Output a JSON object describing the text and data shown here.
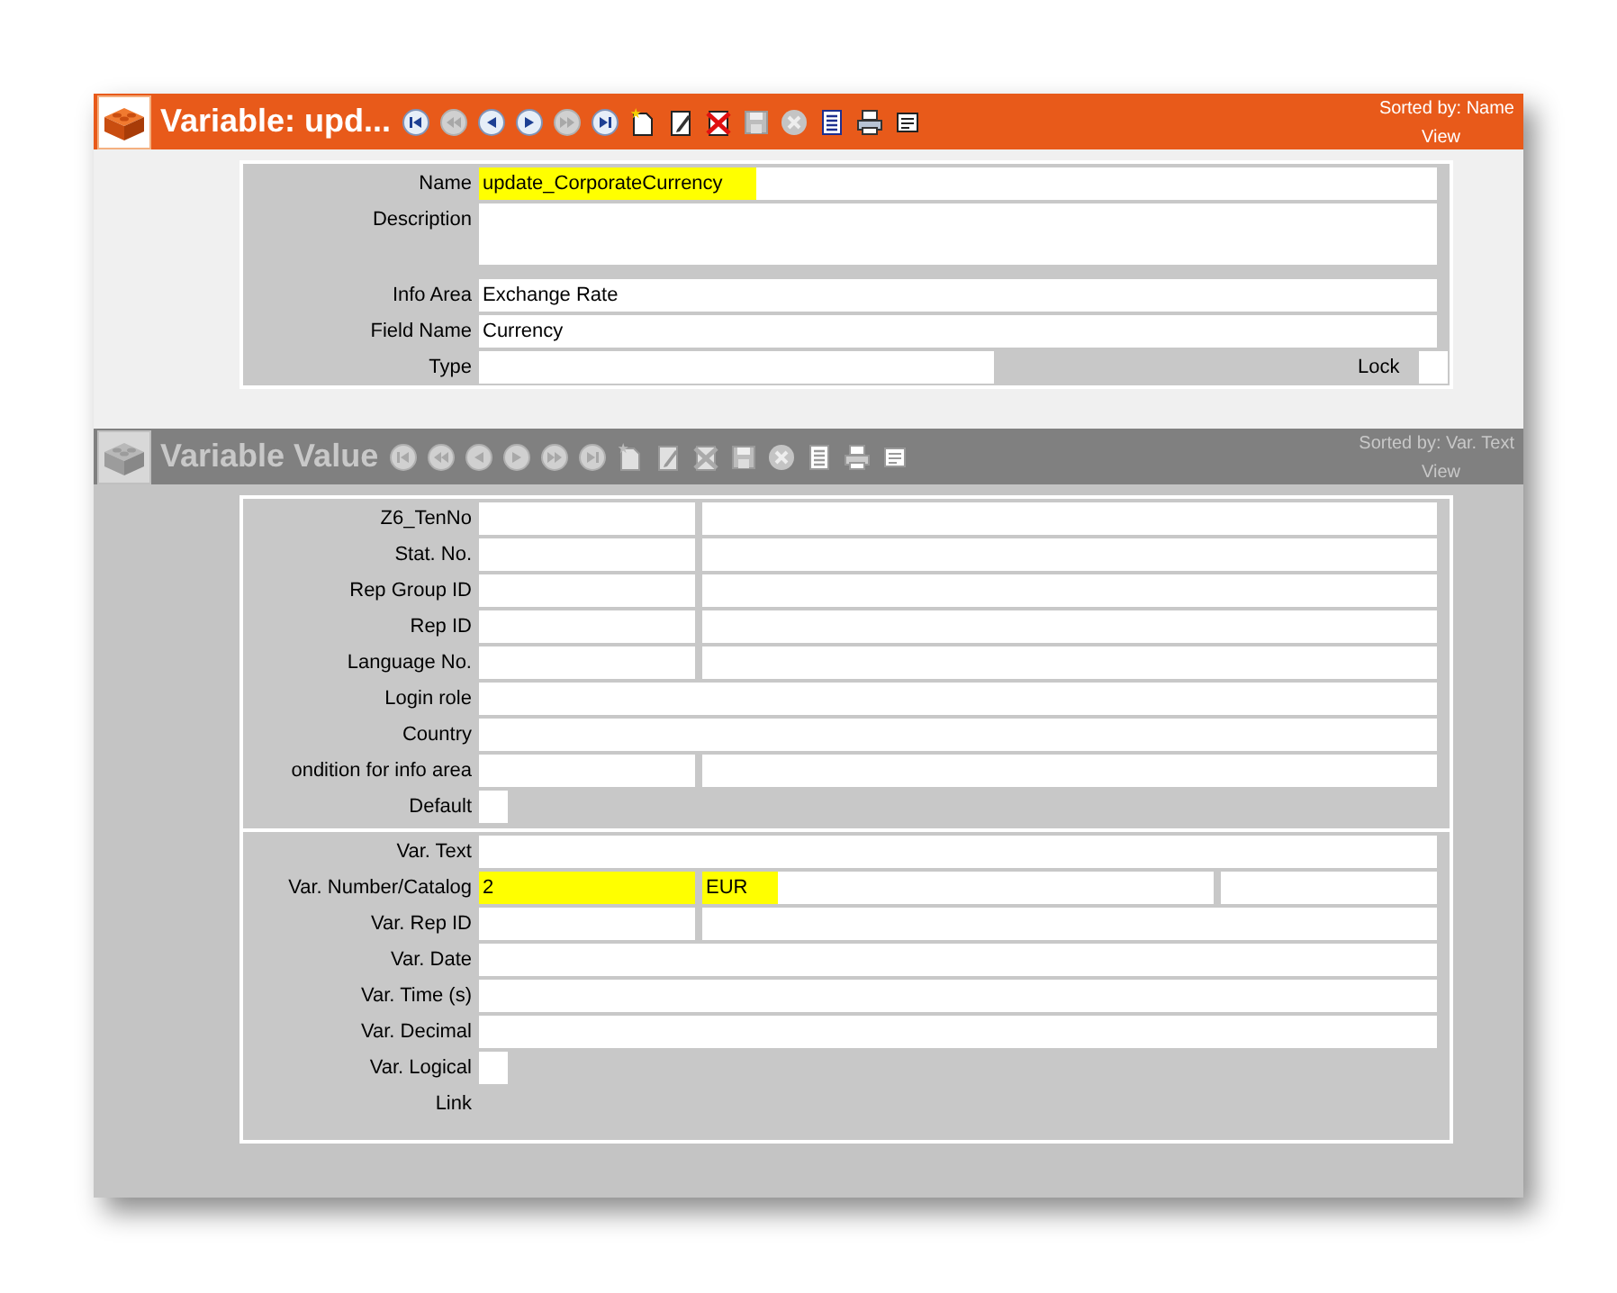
{
  "main_record": {
    "header": {
      "title": "Variable: upd...",
      "active": true,
      "sorted_by": "Sorted by: Name",
      "view": "View"
    },
    "toolbar": [
      {
        "kind": "first",
        "disabled": false
      },
      {
        "kind": "prev_page",
        "disabled": true
      },
      {
        "kind": "prev",
        "disabled": false
      },
      {
        "kind": "next",
        "disabled": false
      },
      {
        "kind": "next_page",
        "disabled": true
      },
      {
        "kind": "last",
        "disabled": false
      },
      {
        "kind": "new",
        "disabled": false
      },
      {
        "kind": "edit",
        "disabled": false
      },
      {
        "kind": "delete",
        "disabled": false
      },
      {
        "kind": "save",
        "disabled": true
      },
      {
        "kind": "cancel",
        "disabled": true
      },
      {
        "kind": "list",
        "disabled": false
      },
      {
        "kind": "print",
        "disabled": false
      },
      {
        "kind": "document",
        "disabled": false
      }
    ],
    "rows": [
      {
        "label": "Name",
        "kind": "full",
        "value": "update_CorporateCurrency",
        "highlighted": true
      },
      {
        "label": "Description",
        "kind": "textarea"
      },
      {
        "label": "Info Area",
        "kind": "full",
        "value": "Exchange Rate",
        "highlighted": false
      },
      {
        "label": "Field Name",
        "kind": "full",
        "value": "Currency",
        "highlighted": false
      },
      {
        "label": "Type",
        "kind": "lock",
        "lock_label": "Lock",
        "lock_checked": false
      }
    ]
  },
  "variable_value": {
    "header": {
      "title": "Variable Value",
      "active": false,
      "sorted_by": "Sorted by: Var. Text",
      "view": "View"
    },
    "toolbar": [
      {
        "kind": "first",
        "disabled": true
      },
      {
        "kind": "prev_page",
        "disabled": true
      },
      {
        "kind": "prev",
        "disabled": true
      },
      {
        "kind": "next",
        "disabled": true
      },
      {
        "kind": "next_page",
        "disabled": true
      },
      {
        "kind": "last",
        "disabled": true
      },
      {
        "kind": "new",
        "disabled": true
      },
      {
        "kind": "edit",
        "disabled": true
      },
      {
        "kind": "delete",
        "disabled": true
      },
      {
        "kind": "save",
        "disabled": true
      },
      {
        "kind": "cancel",
        "disabled": true
      },
      {
        "kind": "list",
        "disabled": true
      },
      {
        "kind": "print",
        "disabled": true
      },
      {
        "kind": "document",
        "disabled": true
      }
    ],
    "sections": [
      {
        "rows": [
          {
            "label": "Z6_TenNo",
            "kind": "split"
          },
          {
            "label": "Stat. No.",
            "kind": "split"
          },
          {
            "label": "Rep Group ID",
            "kind": "split"
          },
          {
            "label": "Rep ID",
            "kind": "split"
          },
          {
            "label": "Language No.",
            "kind": "split"
          },
          {
            "label": "Login role",
            "kind": "full"
          },
          {
            "label": "Country",
            "kind": "full"
          },
          {
            "label": "ondition for info area",
            "kind": "split"
          },
          {
            "label": "Default",
            "kind": "checkbox",
            "checked": false
          }
        ]
      },
      {
        "rows": [
          {
            "label": "Var. Text",
            "kind": "full"
          },
          {
            "label": "Var. Number/Catalog",
            "kind": "triple",
            "value": "2",
            "value_2": "EUR",
            "highlighted": true
          },
          {
            "label": "Var. Rep ID",
            "kind": "split"
          },
          {
            "label": "Var. Date",
            "kind": "full"
          },
          {
            "label": "Var. Time (s)",
            "kind": "full"
          },
          {
            "label": "Var. Decimal",
            "kind": "full"
          },
          {
            "label": "Var. Logical",
            "kind": "checkbox",
            "checked": false
          },
          {
            "label": "Link",
            "kind": "none"
          }
        ]
      }
    ]
  }
}
